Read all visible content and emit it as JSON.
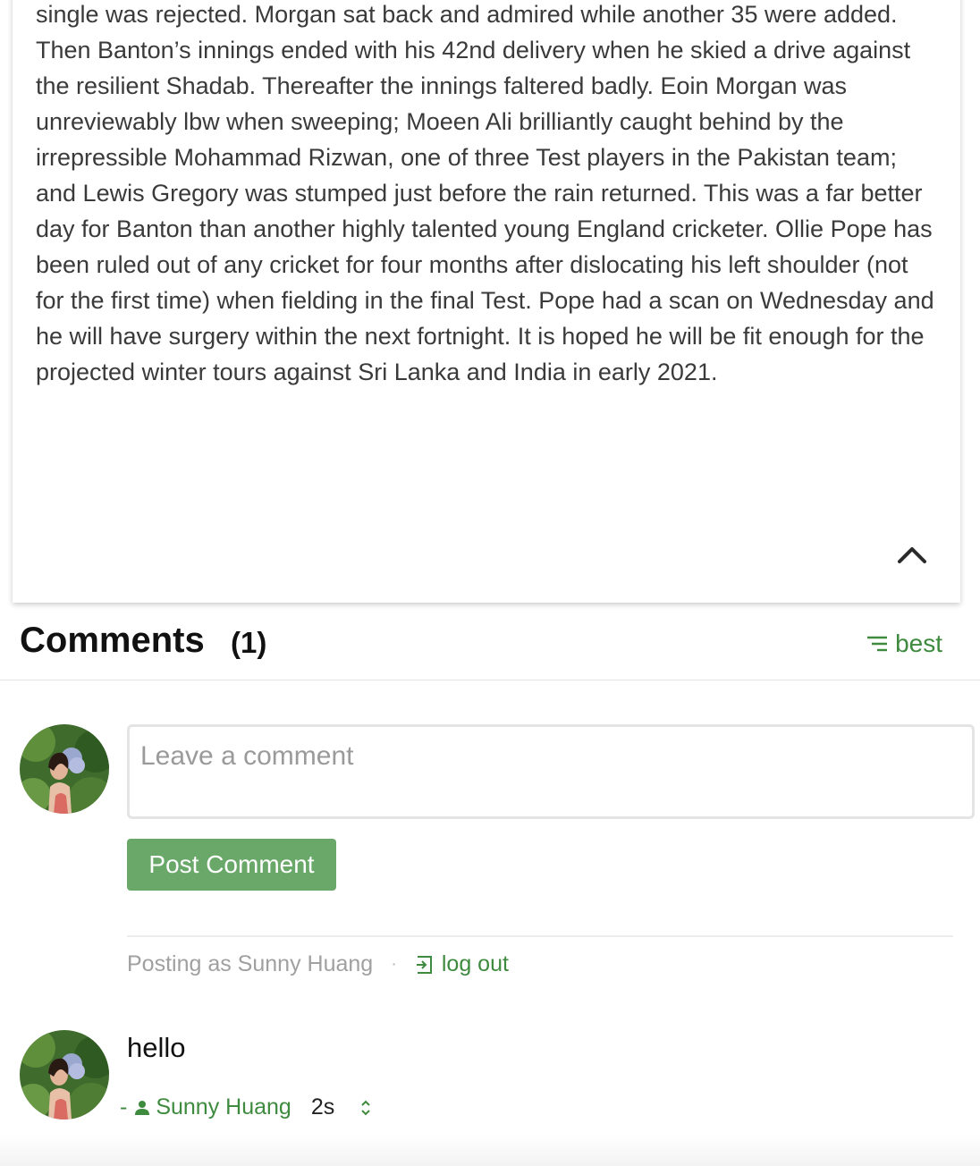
{
  "article": {
    "body": "single was rejected. Morgan sat back and admired while another 35 were added. Then Banton’s innings ended with his 42nd delivery when he skied a drive against the resilient Shadab. Thereafter the innings faltered badly. Eoin Morgan was unreviewably lbw when sweeping; Moeen Ali brilliantly caught behind by the irrepressible Mohammad Rizwan, one of three Test players in the Pakistan team; and Lewis Gregory was stumped just before the rain returned. This was a far better day for Banton than another highly talented young England cricketer. Ollie Pope has been ruled out of any cricket for four months after dislocating his left shoulder (not for the first time) when fielding in the final Test. Pope had a scan on Wednesday and he will have surgery within the next fortnight. It is hoped he will be fit enough for the projected winter tours against Sri Lanka and India in early 2021.",
    "collapse_icon": "chevron-up-icon"
  },
  "comments": {
    "title": "Comments",
    "count": "(1)",
    "sort_label": "best",
    "sort_icon": "sort-lines-icon",
    "input_placeholder": "Leave a comment",
    "input_value": "",
    "post_button_label": "Post Comment",
    "posting_as": "Posting as Sunny Huang",
    "separator": "·",
    "logout_label": "log out",
    "logout_icon": "logout-icon",
    "items": [
      {
        "text": "hello",
        "dash": "-",
        "author": "Sunny Huang",
        "author_icon": "user-icon",
        "time": "2s",
        "vote_icon": "up-down-chevron-icon"
      }
    ]
  },
  "colors": {
    "accent_green": "#3e8a3e",
    "button_green": "#6aa86a",
    "text_gray": "#3a3a3a",
    "muted_gray": "#a0a0a0"
  }
}
